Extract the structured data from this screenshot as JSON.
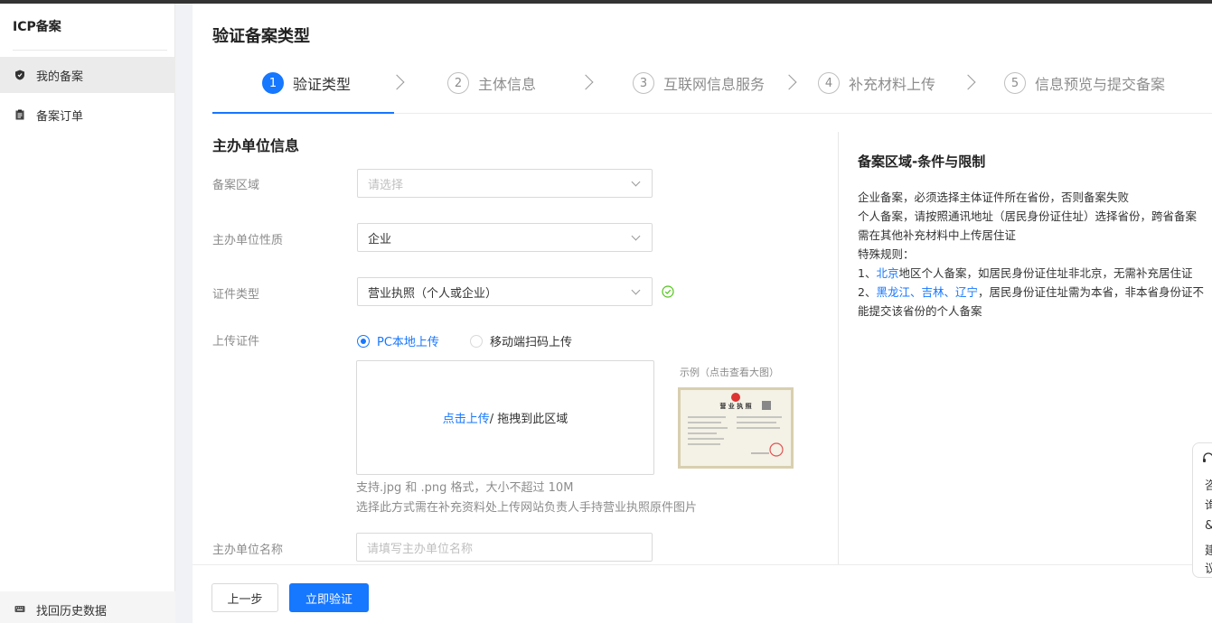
{
  "sidebar": {
    "title": "ICP备案",
    "items": [
      {
        "label": "我的备案",
        "icon": "shield-icon"
      },
      {
        "label": "备案订单",
        "icon": "clipboard-icon"
      }
    ],
    "bottom_item": {
      "label": "找回历史数据",
      "icon": "keyboard-icon"
    }
  },
  "main": {
    "title": "验证备案类型",
    "steps": [
      {
        "num": "1",
        "label": "验证类型"
      },
      {
        "num": "2",
        "label": "主体信息"
      },
      {
        "num": "3",
        "label": "互联网信息服务"
      },
      {
        "num": "4",
        "label": "补充材料上传"
      },
      {
        "num": "5",
        "label": "信息预览与提交备案"
      }
    ],
    "active_step": 1,
    "section_title": "主办单位信息",
    "form": {
      "region": {
        "label": "备案区域",
        "placeholder": "请选择"
      },
      "nature": {
        "label": "主办单位性质",
        "value": "企业"
      },
      "cert_type": {
        "label": "证件类型",
        "value": "营业执照（个人或企业）"
      },
      "upload": {
        "label": "上传证件",
        "option_local": "PC本地上传",
        "option_mobile": "移动端扫码上传",
        "upload_link": "点击上传",
        "upload_rest": " / 拖拽到此区域",
        "example_label": "示例（点击查看大图）",
        "example_title": "营 业 执 照",
        "hint1": "支持.jpg 和 .png 格式，大小不超过 10M",
        "hint2": "选择此方式需在补充资料处上传网站负责人手持营业执照原件图片"
      },
      "org_name": {
        "label": "主办单位名称",
        "placeholder": "请填写主办单位名称"
      }
    },
    "panel": {
      "title": "备案区域-条件与限制",
      "line1": "企业备案，必须选择主体证件所在省份，否则备案失败",
      "line2": "个人备案，请按照通讯地址（居民身份证住址）选择省份，跨省备案需在其他补充材料中上传居住证",
      "line3": "特殊规则：",
      "rule1_prefix": "1、",
      "rule1_blue": "北京",
      "rule1_rest": "地区个人备案，如居民身份证住址非北京，无需补充居住证",
      "rule2_prefix": "2、",
      "rule2_blue": "黑龙江、吉林、辽宁",
      "rule2_rest": "，居民身份证住址需为本省，非本省身份证不能提交该省份的个人备案"
    },
    "footer": {
      "prev": "上一步",
      "submit": "立即验证"
    }
  },
  "float_tool": {
    "c1": "咨",
    "c2": "询",
    "c3": "&",
    "c4": "建",
    "c5": "议"
  },
  "colors": {
    "accent": "#1677ff",
    "success": "#52c41a"
  }
}
